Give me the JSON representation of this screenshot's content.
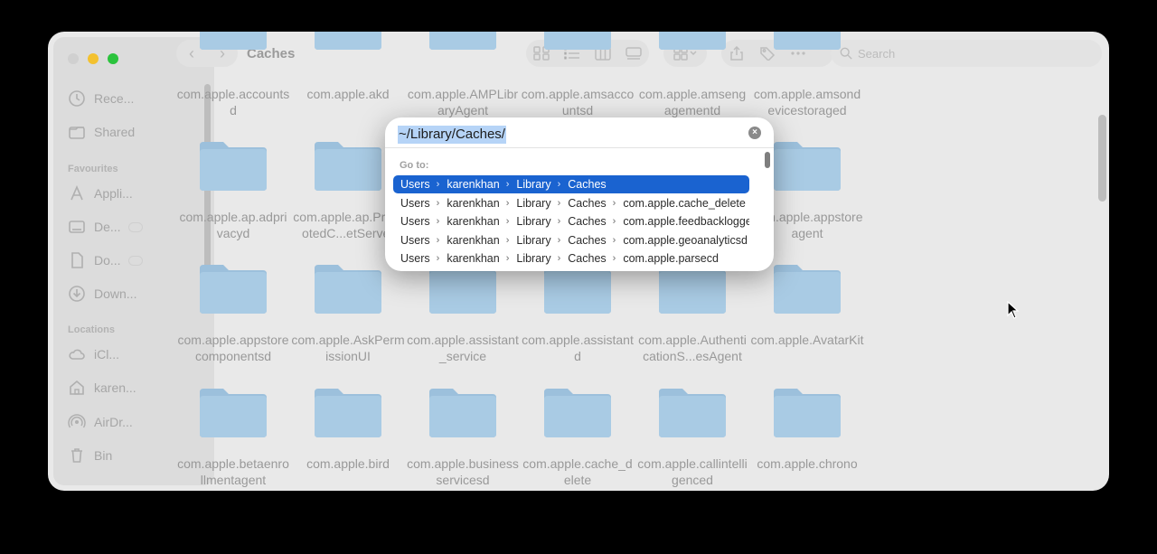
{
  "window": {
    "title": "Caches",
    "search_placeholder": "Search"
  },
  "sidebar": {
    "items": [
      {
        "label": "Rece...",
        "icon": "clock-icon"
      },
      {
        "label": "Shared",
        "icon": "shared-folder-icon"
      }
    ],
    "favourites_heading": "Favourites",
    "favourites": [
      {
        "label": "Appli...",
        "icon": "applications-icon"
      },
      {
        "label": "De...",
        "icon": "desktop-icon"
      },
      {
        "label": "Do...",
        "icon": "document-icon"
      },
      {
        "label": "Down...",
        "icon": "download-icon"
      }
    ],
    "locations_heading": "Locations",
    "locations": [
      {
        "label": "iCl...",
        "icon": "icloud-icon"
      },
      {
        "label": "karen...",
        "icon": "home-icon"
      },
      {
        "label": "AirDr...",
        "icon": "airdrop-icon"
      },
      {
        "label": "Bin",
        "icon": "bin-icon"
      }
    ]
  },
  "files": {
    "row0": [
      "com.apple.accountsd",
      "com.apple.akd",
      "com.apple.AMPLibraryAgent",
      "com.apple.amsaccountsd",
      "com.apple.amsengagementd",
      "com.apple.amsondevicestoraged"
    ],
    "row1": [
      "com.apple.ap.adprivacyd",
      "com.apple.ap.PromotedC...etServer",
      "",
      "",
      "",
      "com.apple.appstoreagent"
    ],
    "row2": [
      "com.apple.appstorecomponentsd",
      "com.apple.AskPermissionUI",
      "com.apple.assistant_service",
      "com.apple.assistantd",
      "com.apple.AuthenticationS...esAgent",
      "com.apple.AvatarKit"
    ],
    "row3": [
      "com.apple.betaenrollmentagent",
      "com.apple.bird",
      "com.apple.businessservicesd",
      "com.apple.cache_delete",
      "com.apple.callintelligenced",
      "com.apple.chrono"
    ]
  },
  "goto": {
    "input_value": "~/Library/Caches/",
    "heading": "Go to:",
    "rows": [
      [
        "Users",
        "karenkhan",
        "Library",
        "Caches"
      ],
      [
        "Users",
        "karenkhan",
        "Library",
        "Caches",
        "com.apple.cache_delete"
      ],
      [
        "Users",
        "karenkhan",
        "Library",
        "Caches",
        "com.apple.feedbacklogger"
      ],
      [
        "Users",
        "karenkhan",
        "Library",
        "Caches",
        "com.apple.geoanalyticsd"
      ],
      [
        "Users",
        "karenkhan",
        "Library",
        "Caches",
        "com.apple.parsecd"
      ]
    ],
    "chevron": "›",
    "selected_row": 0
  },
  "colors": {
    "folder": "#a9cbe4",
    "folder_tab": "#9cc0dc",
    "selection": "#1a63d0",
    "input_highlight": "#b6d4f7"
  }
}
